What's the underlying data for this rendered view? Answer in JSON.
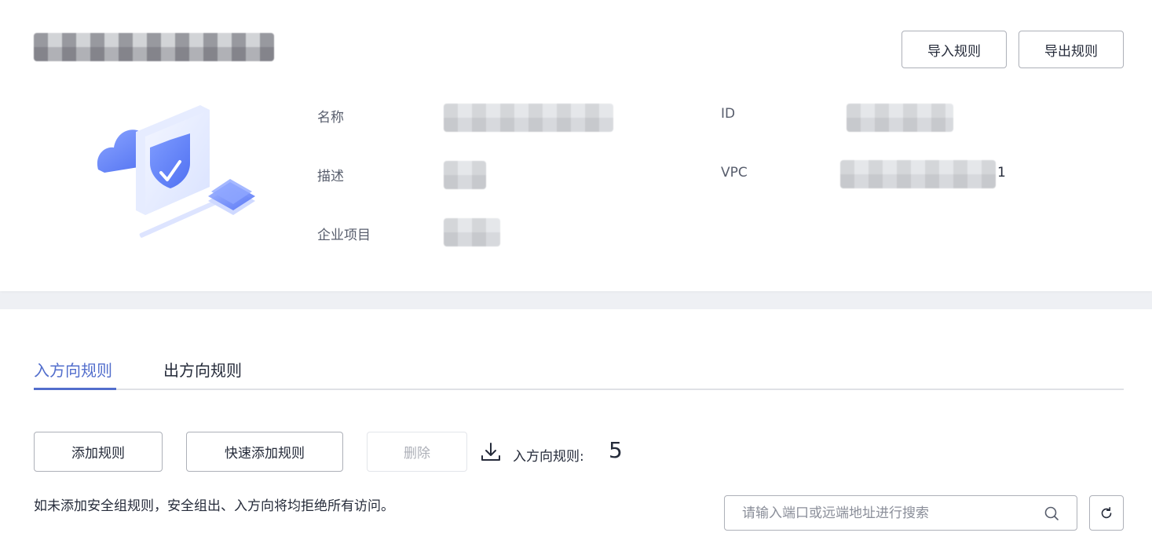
{
  "header": {
    "import_label": "导入规则",
    "export_label": "导出规则"
  },
  "info": {
    "name_label": "名称",
    "desc_label": "描述",
    "project_label": "企业项目",
    "id_label": "ID",
    "vpc_label": "VPC",
    "vpc_suffix": "1"
  },
  "tabs": [
    {
      "label": "入方向规则",
      "active": true
    },
    {
      "label": "出方向规则",
      "active": false
    }
  ],
  "toolbar": {
    "add_label": "添加规则",
    "quick_add_label": "快速添加规则",
    "delete_label": "删除",
    "count_label": "入方向规则:",
    "count_value": "5"
  },
  "notice": "如未添加安全组规则，安全组出、入方向将均拒绝所有访问。",
  "search": {
    "placeholder": "请输入端口或远端地址进行搜索"
  },
  "colors": {
    "accent": "#526ecc",
    "border": "#adb0b8",
    "text": "#252b3a",
    "muted": "#575d6c"
  },
  "icons": {
    "download": "download-icon",
    "search": "search-icon",
    "refresh": "refresh-icon",
    "illustration": "security-shield-illustration"
  }
}
